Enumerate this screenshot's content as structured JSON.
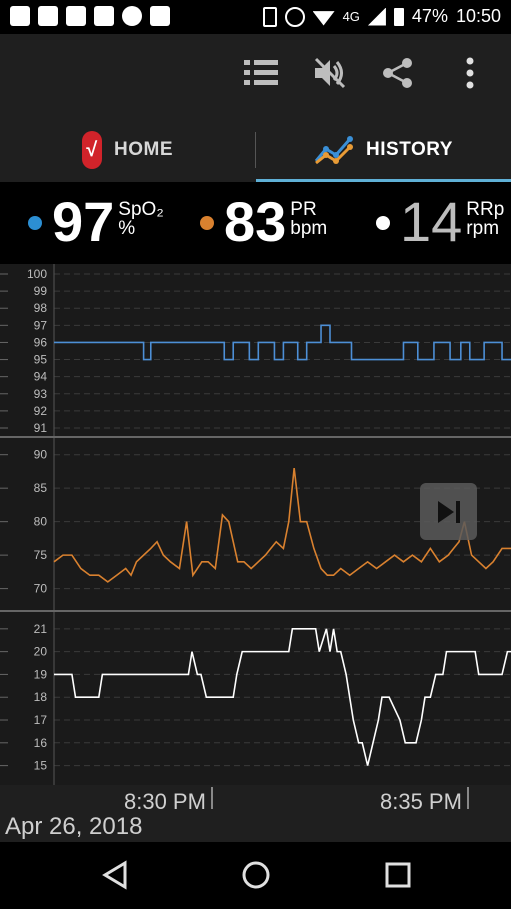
{
  "status": {
    "network": "4G",
    "battery": "47%",
    "time": "10:50"
  },
  "appbar": {
    "icons": [
      "list-icon",
      "mute-icon",
      "share-icon",
      "more-vert-icon"
    ]
  },
  "tabs": {
    "home_label": "HOME",
    "history_label": "HISTORY"
  },
  "vitals": {
    "spo2": {
      "value": "97",
      "unit_top": "SpO₂",
      "unit_bottom": "%",
      "color": "#2c8fd3"
    },
    "pr": {
      "value": "83",
      "unit_top": "PR",
      "unit_bottom": "bpm",
      "color": "#d9812f"
    },
    "rrp": {
      "value": "14",
      "unit_top": "RRp",
      "unit_bottom": "rpm",
      "color": "#ffffff"
    }
  },
  "bottom": {
    "tick1": "8:30 PM",
    "tick2": "8:35 PM",
    "date": "Apr 26, 2018"
  },
  "chart_data": [
    {
      "type": "line",
      "name": "SpO2",
      "yticks": [
        "100",
        "99",
        "98",
        "97",
        "96",
        "95",
        "94",
        "93",
        "92",
        "91"
      ],
      "ylim": [
        91,
        100
      ],
      "series": [
        {
          "color": "#4d8fd6",
          "x": [
            0,
            100,
            100,
            108,
            108,
            190,
            190,
            200,
            200,
            218,
            218,
            228,
            228,
            246,
            246,
            256,
            256,
            272,
            272,
            282,
            282,
            298,
            298,
            308,
            308,
            332,
            332,
            350,
            350,
            390,
            390,
            406,
            406,
            424,
            424,
            442,
            442,
            454,
            454,
            464,
            464,
            480,
            480,
            500,
            500,
            510
          ],
          "y": [
            96,
            96,
            95,
            95,
            96,
            96,
            95,
            95,
            96,
            96,
            95,
            95,
            96,
            96,
            95,
            95,
            96,
            96,
            95,
            95,
            96,
            96,
            97,
            97,
            96,
            96,
            95,
            95,
            95,
            95,
            96,
            96,
            95,
            95,
            96,
            96,
            95,
            95,
            96,
            96,
            95,
            95,
            96,
            96,
            95,
            95
          ]
        }
      ]
    },
    {
      "type": "line",
      "name": "PR",
      "yticks": [
        "90",
        "85",
        "80",
        "75",
        "70"
      ],
      "ylim": [
        68,
        91
      ],
      "series": [
        {
          "color": "#d9812f",
          "x": [
            0,
            10,
            20,
            30,
            40,
            50,
            60,
            70,
            80,
            86,
            92,
            100,
            108,
            115,
            122,
            130,
            140,
            148,
            155,
            165,
            172,
            180,
            188,
            195,
            205,
            212,
            220,
            228,
            236,
            242,
            248,
            256,
            262,
            268,
            275,
            282,
            290,
            298,
            305,
            312,
            320,
            330,
            340,
            350,
            360,
            370,
            380,
            390,
            400,
            410,
            420,
            430,
            440,
            446,
            452,
            458,
            466,
            474,
            482,
            490,
            500,
            510
          ],
          "y": [
            74,
            75,
            75,
            73,
            72,
            72,
            71,
            72,
            73,
            72,
            74,
            75,
            76,
            77,
            75,
            74,
            73,
            80,
            72,
            74,
            74,
            73,
            81,
            80,
            74,
            74,
            73,
            74,
            75,
            76,
            77,
            76,
            80,
            88,
            80,
            80,
            76,
            73,
            72,
            72,
            73,
            72,
            73,
            74,
            73,
            74,
            75,
            74,
            75,
            74,
            76,
            74,
            75,
            76,
            77,
            80,
            75,
            74,
            73,
            74,
            76,
            76
          ]
        }
      ]
    },
    {
      "type": "line",
      "name": "RRp",
      "yticks": [
        "21",
        "20",
        "19",
        "18",
        "17",
        "16",
        "15"
      ],
      "ylim": [
        14.5,
        21.3
      ],
      "series": [
        {
          "color": "#ffffff",
          "x": [
            0,
            20,
            24,
            50,
            54,
            100,
            104,
            150,
            154,
            160,
            164,
            170,
            174,
            200,
            204,
            210,
            214,
            242,
            244,
            262,
            266,
            292,
            296,
            304,
            308,
            312,
            316,
            320,
            326,
            330,
            334,
            340,
            344,
            350,
            356,
            362,
            366,
            370,
            374,
            386,
            392,
            396,
            404,
            410,
            414,
            420,
            426,
            434,
            438,
            470,
            474,
            500,
            506,
            510
          ],
          "y": [
            19,
            19,
            18,
            18,
            19,
            19,
            19,
            19,
            20,
            19,
            19,
            18,
            18,
            18,
            19,
            20,
            20,
            20,
            20,
            20,
            21,
            21,
            20,
            21,
            20,
            21,
            20,
            20,
            19,
            18,
            17,
            16,
            16,
            15,
            16,
            17,
            18,
            18,
            18,
            17,
            16,
            16,
            16,
            17,
            18,
            18,
            19,
            19,
            20,
            20,
            19,
            19,
            20,
            20
          ]
        }
      ]
    }
  ]
}
